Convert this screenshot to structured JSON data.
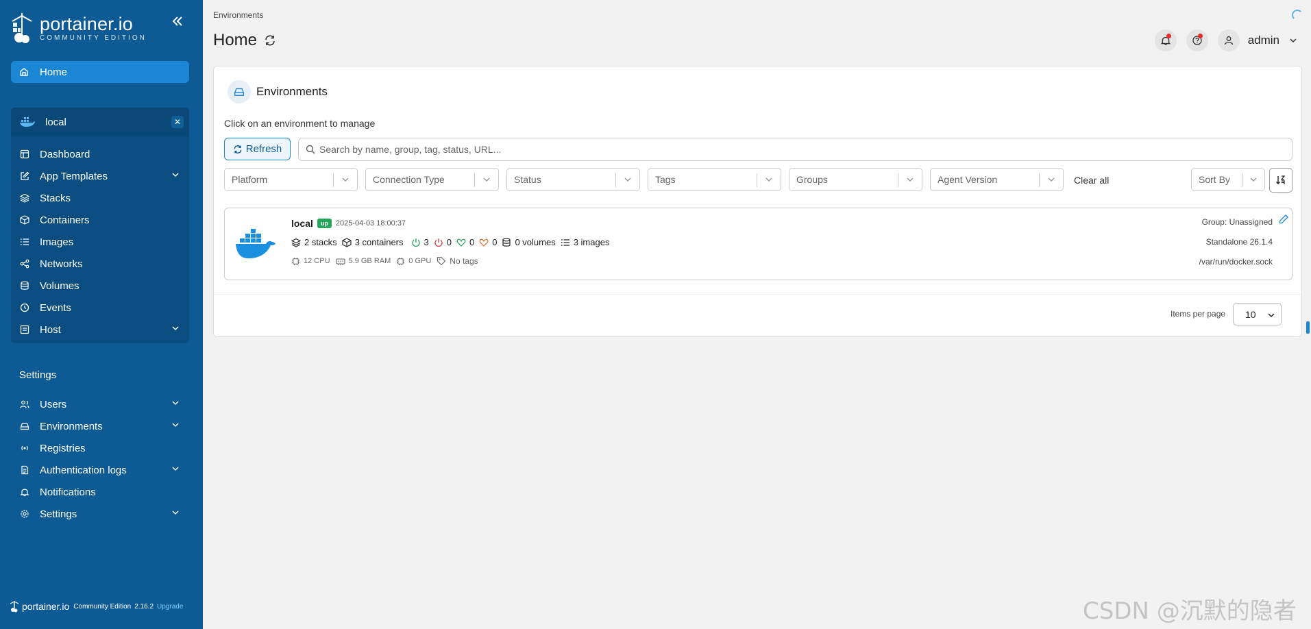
{
  "sidebar": {
    "brand": {
      "name": "portainer.io",
      "edition": "COMMUNITY EDITION"
    },
    "home": {
      "label": "Home"
    },
    "environment": {
      "name": "local",
      "items": [
        {
          "label": "Dashboard",
          "icon": "dashboard-icon",
          "expandable": false
        },
        {
          "label": "App Templates",
          "icon": "edit-icon",
          "expandable": true
        },
        {
          "label": "Stacks",
          "icon": "layers-icon",
          "expandable": false
        },
        {
          "label": "Containers",
          "icon": "box-icon",
          "expandable": false
        },
        {
          "label": "Images",
          "icon": "list-icon",
          "expandable": false
        },
        {
          "label": "Networks",
          "icon": "share-icon",
          "expandable": false
        },
        {
          "label": "Volumes",
          "icon": "database-icon",
          "expandable": false
        },
        {
          "label": "Events",
          "icon": "clock-icon",
          "expandable": false
        },
        {
          "label": "Host",
          "icon": "host-icon",
          "expandable": true
        }
      ]
    },
    "settings_title": "Settings",
    "settings_items": [
      {
        "label": "Users",
        "icon": "users-icon",
        "expandable": true
      },
      {
        "label": "Environments",
        "icon": "hdd-icon",
        "expandable": true
      },
      {
        "label": "Registries",
        "icon": "radio-icon",
        "expandable": false
      },
      {
        "label": "Authentication logs",
        "icon": "file-icon",
        "expandable": true
      },
      {
        "label": "Notifications",
        "icon": "bell-icon",
        "expandable": false
      },
      {
        "label": "Settings",
        "icon": "gear-icon",
        "expandable": true
      }
    ],
    "footer": {
      "brand": "portainer.io",
      "edition": "Community Edition",
      "version": "2.16.2",
      "upgrade": "Upgrade"
    }
  },
  "header": {
    "breadcrumb": "Environments",
    "title": "Home",
    "user": "admin"
  },
  "panel": {
    "title": "Environments",
    "description": "Click on an environment to manage",
    "refresh_label": "Refresh",
    "search_placeholder": "Search by name, group, tag, status, URL...",
    "filters": [
      "Platform",
      "Connection Type",
      "Status",
      "Tags",
      "Groups",
      "Agent Version"
    ],
    "clear_all": "Clear all",
    "sort_by": "Sort By",
    "environment_card": {
      "name": "local",
      "status": "up",
      "timestamp": "2025-04-03 18:00:37",
      "stacks": "2 stacks",
      "containers": "3 containers",
      "running": "3",
      "stopped": "0",
      "healthy": "0",
      "unhealthy": "0",
      "volumes": "0 volumes",
      "images": "3 images",
      "cpu": "12 CPU",
      "ram": "5.9 GB RAM",
      "gpu": "0 GPU",
      "tags": "No tags",
      "group": "Group: Unassigned",
      "type": "Standalone 26.1.4",
      "url": "/var/run/docker.sock"
    },
    "items_per_page_label": "Items per page",
    "items_per_page": "10"
  },
  "watermark": "CSDN @沉默的隐者",
  "colors": {
    "sidebar": "#0d5a94",
    "accent": "#1b86d4",
    "status_up": "#23a55a"
  }
}
